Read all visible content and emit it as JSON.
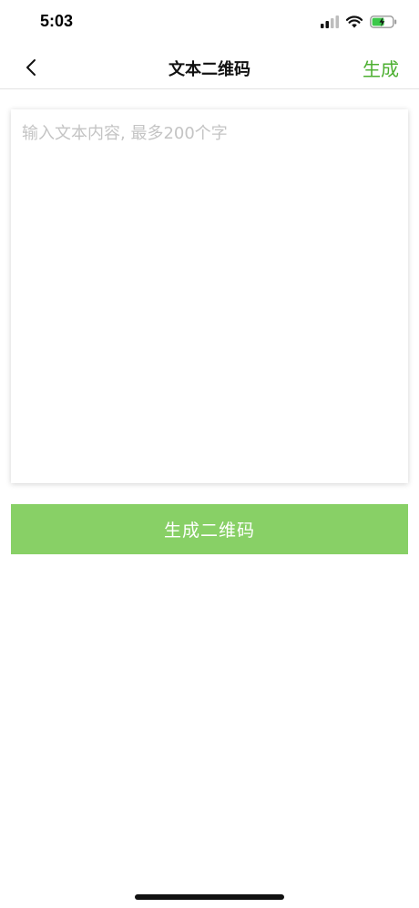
{
  "status_bar": {
    "time": "5:03",
    "icons": [
      "signal-icon",
      "wifi-icon",
      "battery-charging-icon"
    ]
  },
  "nav": {
    "back_icon": "chevron-left-icon",
    "title": "文本二维码",
    "action_label": "生成"
  },
  "text_input": {
    "placeholder": "输入文本内容, 最多200个字",
    "value": ""
  },
  "generate_button": {
    "label": "生成二维码"
  },
  "colors": {
    "accent": "#4caf30",
    "button_bg": "#88d066",
    "placeholder": "#c4c4c4",
    "battery_fill": "#3cc84a"
  }
}
